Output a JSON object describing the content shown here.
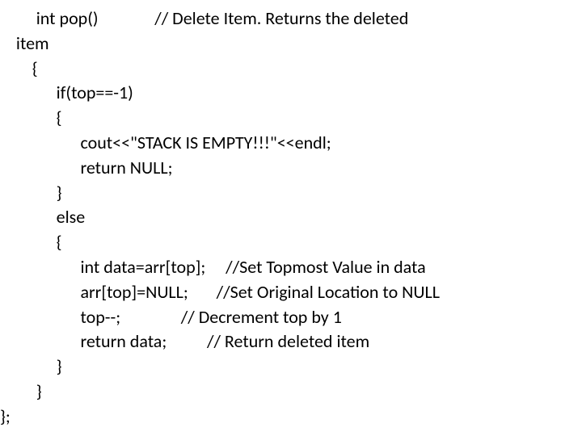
{
  "code": {
    "l1": "         int pop()              // Delete Item. Returns the deleted",
    "l2": "    item",
    "l3": "        {",
    "l4": "              if(top==-1)",
    "l5": "              {",
    "l6": "                    cout<<\"STACK IS EMPTY!!!\"<<endl;",
    "l7": "                    return NULL;",
    "l8": "              }",
    "l9": "              else",
    "l10": "              {",
    "l11": "                    int data=arr[top];     //Set Topmost Value in data",
    "l12": "                    arr[top]=NULL;       //Set Original Location to NULL",
    "l13": "                    top--;               // Decrement top by 1",
    "l14": "                    return data;          // Return deleted item",
    "l15": "              }",
    "l16": "         }",
    "l17": "};"
  }
}
